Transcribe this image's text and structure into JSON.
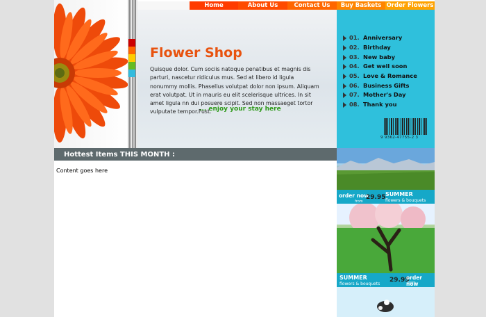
{
  "nav": {
    "items": [
      {
        "label": "Home",
        "color": "#ff3b00",
        "width": 70
      },
      {
        "label": "About Us",
        "color": "#ff4b00",
        "width": 71
      },
      {
        "label": "Contact Us",
        "color": "#ff6600",
        "width": 71
      },
      {
        "label": "Buy Baskets",
        "color": "#ff8500",
        "width": 70
      },
      {
        "label": "Order Flowers",
        "color": "#ffa200",
        "width": 71
      }
    ]
  },
  "hero": {
    "title": "Flower Shop",
    "text": "Quisque dolor. Cum sociis natoque penatibus et magnis dis parturi, nascetur ridiculus mus. Sed at libero id ligula nonummy mollis. Phasellus volutpat dolor non ipsum. Aliquam erat volutpat. Ut in mauris eu elit scelerisque ultrices. In sit amet ligula nn dui posuere scipit. Sed non massaeget tortor vulputate tempor.Fust.",
    "tagline": "... enjoy your stay here"
  },
  "occasions": [
    {
      "num": "01.",
      "label": "Anniversary"
    },
    {
      "num": "02.",
      "label": "Birthday"
    },
    {
      "num": "03.",
      "label": "New baby"
    },
    {
      "num": "04.",
      "label": "Get well soon"
    },
    {
      "num": "05.",
      "label": "Love & Romance"
    },
    {
      "num": "06.",
      "label": "Business Gifts"
    },
    {
      "num": "07.",
      "label": "Mother's Day"
    },
    {
      "num": "08.",
      "label": "Thank you"
    }
  ],
  "barcode": {
    "number": "9 9362-47755-2 3"
  },
  "hottest": {
    "title": "Hottest Items THIS MONTH :"
  },
  "content": {
    "text": "Content goes here"
  },
  "banner1": {
    "order": "order now",
    "from": "from",
    "price": "29.95",
    "summer": "SUMMER",
    "sub": "flowers & bouquets"
  },
  "banner2": {
    "order": "order now",
    "from": "from",
    "price": "29.95",
    "summer": "SUMMER",
    "sub": "flowers & bouquets"
  },
  "swatches": [
    "#cc0000",
    "#ff6600",
    "#ffcc00",
    "#66bb22",
    "#33bbdd"
  ]
}
